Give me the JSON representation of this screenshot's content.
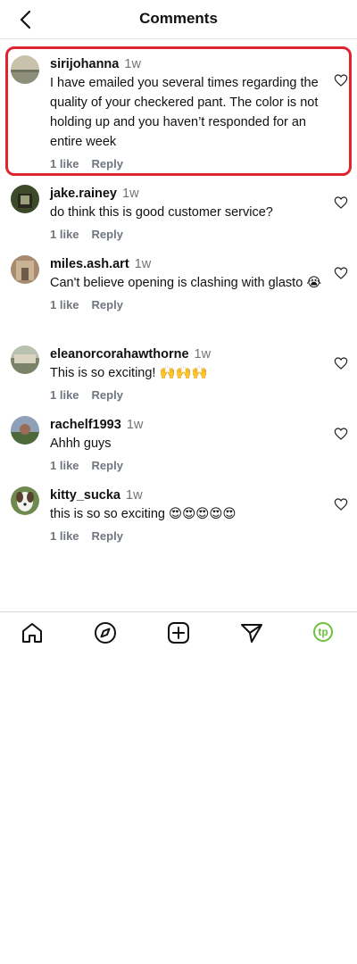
{
  "header": {
    "title": "Comments"
  },
  "comments": [
    {
      "username": "sirijohanna",
      "time": "1w",
      "text": "I have emailed you several times regarding the quality of your checkered pant. The color is not holding up and you haven’t responded for an entire week",
      "likes": "1 like",
      "reply": "Reply"
    },
    {
      "username": "jake.rainey",
      "time": "1w",
      "text": "do think this is good customer service?",
      "likes": "1 like",
      "reply": "Reply"
    },
    {
      "username": "miles.ash.art",
      "time": "1w",
      "text": "Can't believe opening is clashing with glasto 😭",
      "likes": "1 like",
      "reply": "Reply"
    },
    {
      "username": "eleanorcorahawthorne",
      "time": "1w",
      "text": "This is so exciting! 🙌🙌🙌",
      "likes": "1 like",
      "reply": "Reply"
    },
    {
      "username": "rachelf1993",
      "time": "1w",
      "text": "Ahhh guys",
      "likes": "1 like",
      "reply": "Reply"
    },
    {
      "username": "kitty_sucka",
      "time": "1w",
      "text": "this is so so exciting 😍😍😍😍😍",
      "likes": "1 like",
      "reply": "Reply"
    }
  ],
  "nav": {
    "profile_logo": "tp"
  },
  "colors": {
    "highlight": "#e0242f",
    "brand": "#6bc13b"
  },
  "icons": [
    "back-arrow-icon",
    "heart-icon",
    "home-icon",
    "explore-icon",
    "add-post-icon",
    "send-icon"
  ]
}
